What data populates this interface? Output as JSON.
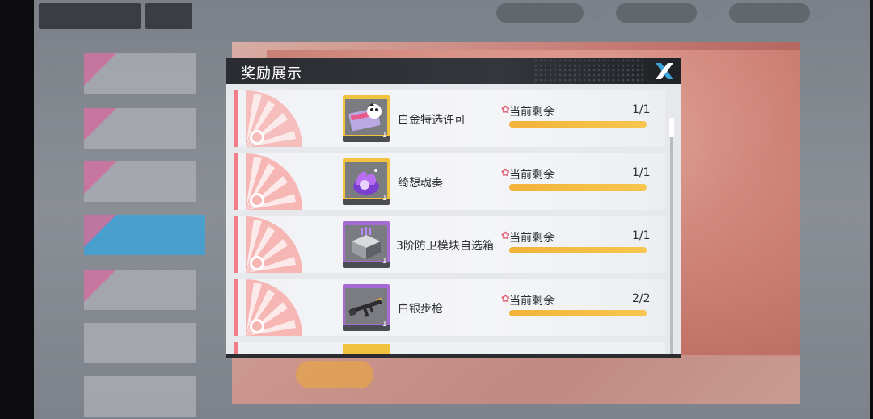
{
  "dialog": {
    "title": "奖励展示",
    "remain_label": "当前剩余"
  },
  "rewards": [
    {
      "name": "白金特选许可",
      "count": "1",
      "remaining": "1/1",
      "remaining_fraction": 1.0,
      "frame": "gold",
      "icon": "ticket-icon"
    },
    {
      "name": "绮想魂奏",
      "count": "1",
      "remaining": "1/1",
      "remaining_fraction": 1.0,
      "frame": "gold",
      "icon": "purple-orb-icon"
    },
    {
      "name": "3阶防卫模块自选箱",
      "count": "1",
      "remaining": "1/1",
      "remaining_fraction": 1.0,
      "frame": "purple",
      "icon": "crate-icon"
    },
    {
      "name": "白银步枪",
      "count": "1",
      "remaining": "2/2",
      "remaining_fraction": 1.0,
      "frame": "purple",
      "icon": "rifle-icon"
    }
  ],
  "colors": {
    "gold": "#f0c23d",
    "purple": "#a56bd5",
    "accent": "#f07e88",
    "bar": "#f2b338"
  }
}
